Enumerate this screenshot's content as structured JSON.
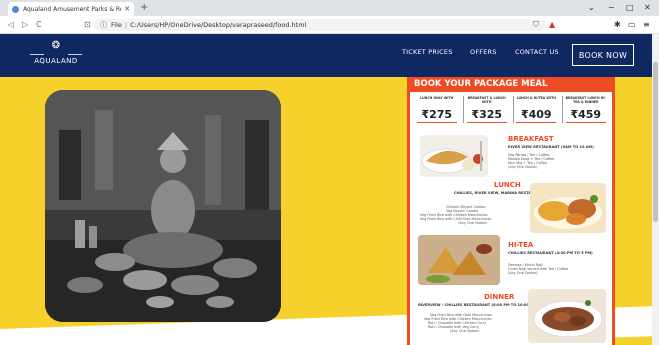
{
  "browser": {
    "tab_title": "Aqualand Amusement Parks & Re",
    "tab_close": "✕",
    "new_tab": "+",
    "address_info": "ⓘ",
    "address_prefix": "File",
    "address_url": "C:/Users/HP/OneDrive/Desktop/varapraseed/food.html",
    "back_icon": "◁",
    "forward_icon": "▷",
    "reload_icon": "C",
    "bookmark_icon": "⊡",
    "minimize": "−",
    "maximize": "□",
    "close": "✕"
  },
  "nav": {
    "logo_text": "AQUALAND",
    "links": [
      "TICKET PRICES",
      "OFFERS",
      "CONTACT US"
    ],
    "book_now": "BOOK NOW"
  },
  "menu": {
    "heading": "BOOK YOUR PACKAGE MEAL",
    "prices": [
      {
        "caption": "LUNCH ONLY WITH",
        "value": "₹275"
      },
      {
        "caption": "BREAKFAST & LUNCH WITH",
        "value": "₹325"
      },
      {
        "caption": "LUNCH & HI-TEA WITH",
        "value": "₹409"
      },
      {
        "caption": "BREAKFAST LUNCH HI-TEA & DINNER",
        "value": "₹459"
      }
    ],
    "meals": [
      {
        "title": "BREAKFAST",
        "sub": "RIVER VIEW RESTAURANT (9AM TO 10 AM)",
        "desc": [
          "Veg Parata / Tea / Coffee",
          "Masala Dosa + Tea / Coffee",
          "Non Veg + Tea / Coffee",
          "(Any One Option)"
        ]
      },
      {
        "title": "LUNCH",
        "sub": "CHILLIES, RIVER VIEW, MARINA RESTAURANT (12:30PM TO 3:30PM)",
        "desc": [
          "Chicken Biryani Combo",
          "Veg Biryani Combo",
          "Veg Fried Rice with Chicken Manchurian",
          "Veg Fried Rice with Chilli Gobi Manchurian",
          "(Any One Option)"
        ]
      },
      {
        "title": "HI-TEA",
        "sub": "CHILLIES RESTAURANT (4:30 PM TO 5 PM)",
        "desc": [
          "Samosa / Mirchi Bajji",
          "Onion Bajji served with Tea / Coffee",
          "(Any One Option)"
        ]
      },
      {
        "title": "DINNER",
        "sub": "RIVERVIEW / CHILLIES RESTAURANT (8:00 PM TO 10:00 PM)",
        "desc": [
          "Veg Fried Rice with Gobi Manchurian",
          "Veg Fried Rice with Chicken Manchurian",
          "Roti / Chapathi with Chicken Curry",
          "Roti / Chapathi with Veg Curry",
          "(Any One Option)"
        ]
      }
    ]
  },
  "colors": {
    "nav_bg": "#0f2862",
    "hero_bg": "#f7d12b",
    "accent": "#ef4b24"
  }
}
